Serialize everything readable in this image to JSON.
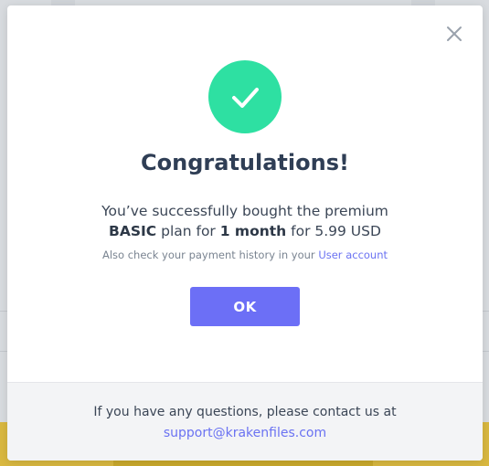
{
  "modal": {
    "title": "Congratulations!",
    "message_line1": "You’ve successfully bought the premium",
    "plan_name": "BASIC",
    "plan_for_text": " plan for ",
    "duration": "1 month",
    "price_text": " for 5.99 USD",
    "note_text": "Also check your payment history in your ",
    "note_link": "User account",
    "ok_label": "OK",
    "footer_text": "If you have any questions, please contact us at",
    "support_email": "support@krakenfiles.com",
    "icons": {
      "close": "close-icon",
      "success": "checkmark-icon"
    }
  },
  "colors": {
    "success_green": "#2ee0a2",
    "accent": "#6c6ff6",
    "link": "#6a72f2",
    "title": "#2f3e55",
    "footer_bg": "#f3f4f6"
  }
}
